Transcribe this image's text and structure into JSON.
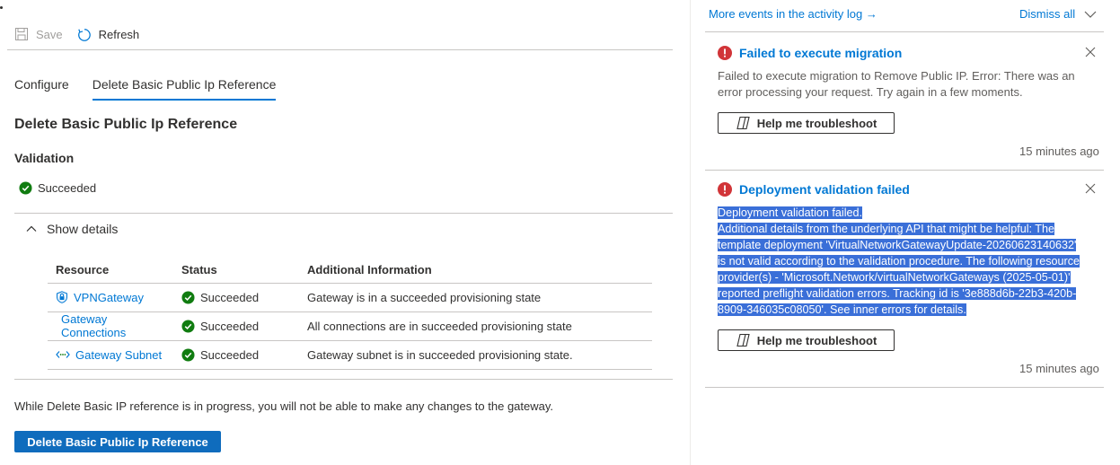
{
  "toolbar": {
    "save_label": "Save",
    "refresh_label": "Refresh"
  },
  "tabs": [
    {
      "label": "Configure",
      "active": false
    },
    {
      "label": "Delete Basic Public Ip Reference",
      "active": true
    }
  ],
  "main": {
    "section_title": "Delete Basic Public Ip Reference",
    "validation_label": "Validation",
    "validation_status": "Succeeded",
    "show_details_label": "Show details",
    "table": {
      "headers": [
        "Resource",
        "Status",
        "Additional Information"
      ],
      "rows": [
        {
          "resource": "VPNGateway",
          "icon": "vpn-gateway-icon",
          "status": "Succeeded",
          "info": "Gateway is in a succeeded provisioning state"
        },
        {
          "resource": "Gateway Connections",
          "icon": "",
          "status": "Succeeded",
          "info": "All connections are in succeeded provisioning state"
        },
        {
          "resource": "Gateway Subnet",
          "icon": "subnet-icon",
          "status": "Succeeded",
          "info": "Gateway subnet is in succeeded provisioning state."
        }
      ]
    },
    "note": "While Delete Basic IP reference is in progress, you will not be able to make any changes to the gateway.",
    "primary_button": "Delete Basic Public Ip Reference"
  },
  "notifications_pane": {
    "activity_link": "More events in the activity log →",
    "dismiss_all": "Dismiss all",
    "items": [
      {
        "title": "Failed to execute migration",
        "body": "Failed to execute migration to Remove Public IP. Error: There was an error processing your request. Try again in a few moments.",
        "button": "Help me troubleshoot",
        "time": "15 minutes ago"
      },
      {
        "title": "Deployment validation failed",
        "body_lines": [
          "Deployment validation failed.",
          "Additional details from the underlying API that might be helpful: The",
          "template deployment 'VirtualNetworkGatewayUpdate-20260623140632'",
          "is not valid according to the validation procedure. The following resource",
          "provider(s) - 'Microsoft.Network/virtualNetworkGateways (2025-05-01)'",
          "reported preflight validation errors. Tracking id is '3e888d6b-22b3-420b-",
          "8909-346035c08050'. See inner errors for details."
        ],
        "button": "Help me troubleshoot",
        "time": "15 minutes ago"
      }
    ]
  },
  "colors": {
    "accent": "#0078d4",
    "primary_button": "#0f6cbd",
    "success": "#107c10",
    "error": "#d13438",
    "selection": "#3a6fd8"
  }
}
